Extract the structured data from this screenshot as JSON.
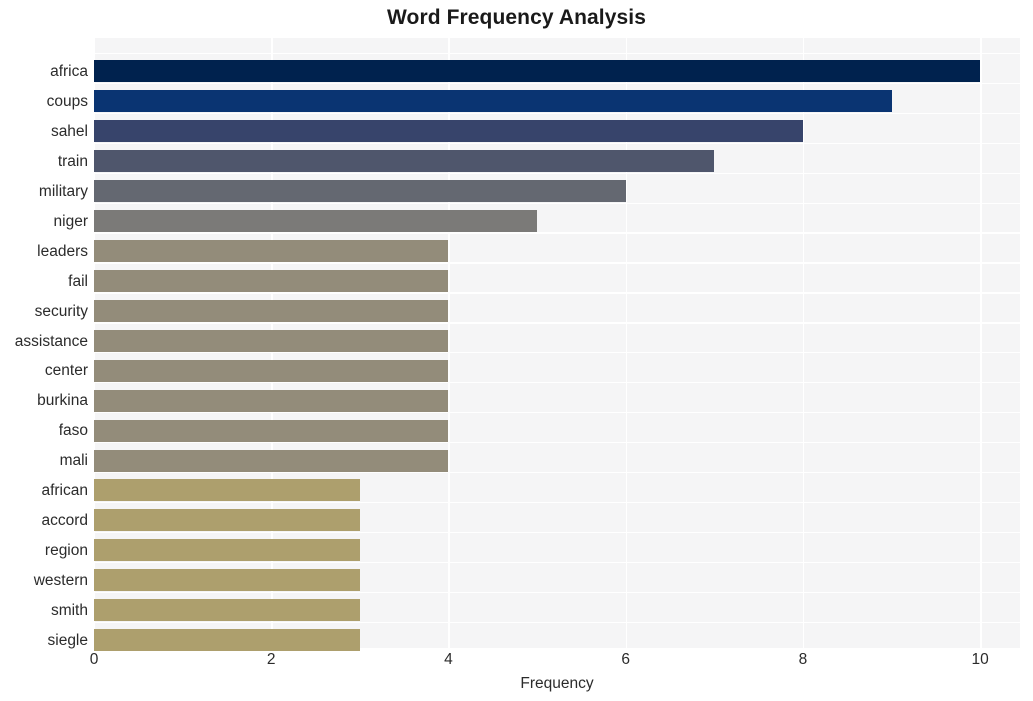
{
  "chart_data": {
    "type": "bar",
    "orientation": "horizontal",
    "title": "Word Frequency Analysis",
    "xlabel": "Frequency",
    "ylabel": "",
    "categories": [
      "africa",
      "coups",
      "sahel",
      "train",
      "military",
      "niger",
      "leaders",
      "fail",
      "security",
      "assistance",
      "center",
      "burkina",
      "faso",
      "mali",
      "african",
      "accord",
      "region",
      "western",
      "smith",
      "siegle"
    ],
    "values": [
      10,
      9,
      8,
      7,
      6,
      5,
      4,
      4,
      4,
      4,
      4,
      4,
      4,
      4,
      3,
      3,
      3,
      3,
      3,
      3
    ],
    "xlim": [
      0,
      10.45
    ],
    "xticks": [
      0,
      2,
      4,
      6,
      8,
      10
    ],
    "xtick_labels": [
      "0",
      "2",
      "4",
      "6",
      "8",
      "10"
    ],
    "grid": true,
    "legend": false,
    "bar_colors": [
      "#00224e",
      "#0a3472",
      "#37446b",
      "#4f566c",
      "#646871",
      "#7b7a78",
      "#938c7a",
      "#938c7a",
      "#938c7a",
      "#938c7a",
      "#938c7a",
      "#938c7a",
      "#938c7a",
      "#938c7a",
      "#ad9f6d",
      "#ad9f6d",
      "#ad9f6d",
      "#ad9f6d",
      "#ad9f6d",
      "#ad9f6d"
    ],
    "plot_background": "#f5f5f6",
    "grid_color": "#ffffff",
    "figure_background": "#ffffff",
    "text_color": "#2b2b2b"
  }
}
